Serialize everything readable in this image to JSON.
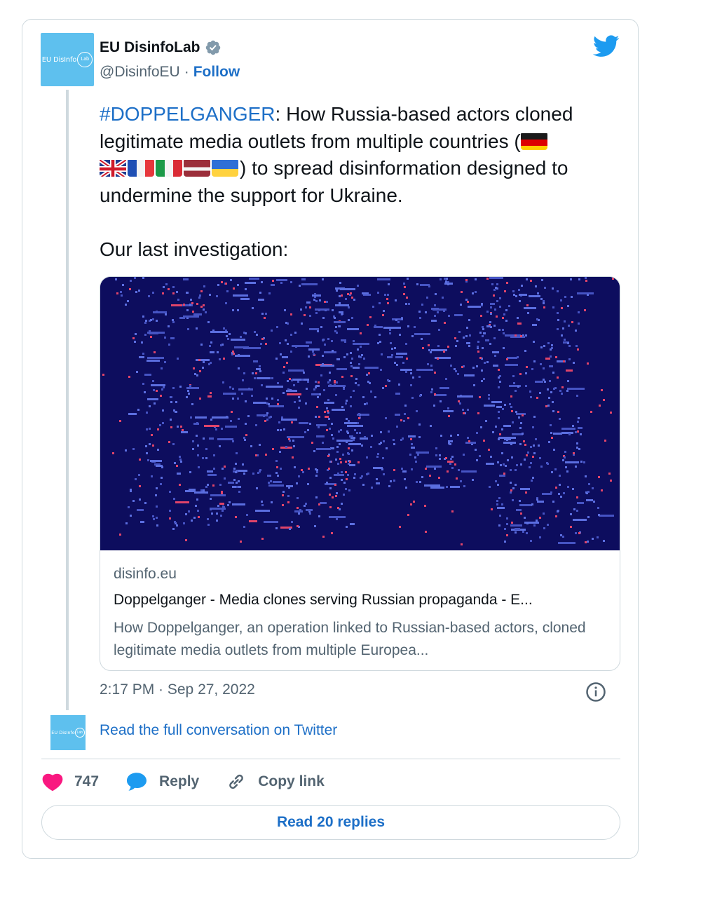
{
  "author": {
    "display_name": "EU DisinfoLab",
    "handle": "@DisinfoEU",
    "separator": "·",
    "follow_label": "Follow",
    "avatar_text": "EU DisinfoLab",
    "avatar_text_main": "EU DisInfo",
    "avatar_text_circle": "Lab"
  },
  "tweet": {
    "hashtag": "#DOPPELGANGER",
    "text_part1": ": How Russia-based actors cloned legitimate media outlets from multiple countries (",
    "text_part2": ") to spread disinformation designed to undermine the support for Ukraine.",
    "text_part3": "Our last investigation:",
    "flags": [
      "de",
      "gb",
      "fr",
      "it",
      "lv",
      "ua"
    ]
  },
  "link_card": {
    "domain": "disinfo.eu",
    "title": "Doppelganger - Media clones serving Russian propaganda - E...",
    "description": "How Doppelganger, an operation linked to Russian-based actors, cloned legitimate media outlets from multiple Europea..."
  },
  "timestamp": "2:17 PM · Sep 27, 2022",
  "read_conversation": "Read the full conversation on Twitter",
  "actions": {
    "likes": "747",
    "reply_label": "Reply",
    "copy_label": "Copy link"
  },
  "read_replies": "Read 20 replies",
  "colors": {
    "link_blue": "#1d6fc7",
    "avatar_blue": "#5ec0ee",
    "like_pink": "#f91880",
    "reply_blue": "#1d9bf0",
    "image_bg": "#0d0d5e",
    "image_dots": "#5b6ee0"
  },
  "icons": [
    "verified-badge-icon",
    "twitter-bird-icon",
    "info-icon",
    "heart-icon",
    "reply-bubble-icon",
    "link-icon"
  ]
}
